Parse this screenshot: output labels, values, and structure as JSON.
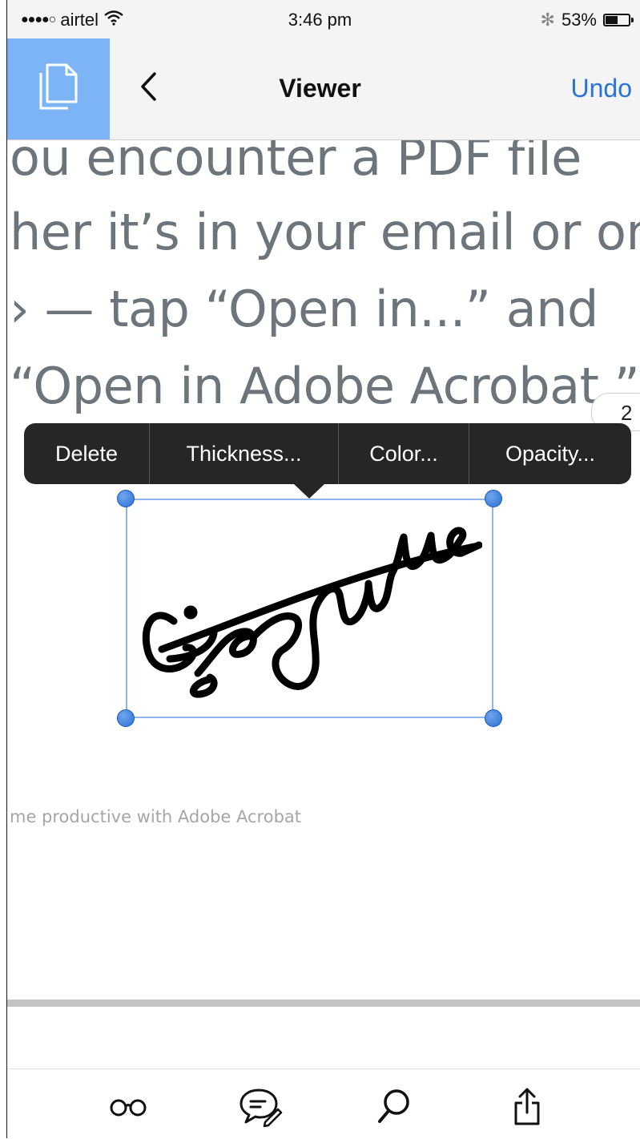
{
  "status_bar": {
    "signal_dots": "●●●●○",
    "carrier": "airtel",
    "time": "3:46 pm",
    "bluetooth_glyph": "✻",
    "battery_percent": "53%",
    "battery_level": 0.53,
    "wifi_icon": "wifi-icon",
    "bluetooth_icon": "bluetooth-icon",
    "battery_icon": "battery-icon"
  },
  "nav": {
    "title": "Viewer",
    "undo_label": "Undo",
    "documents_icon": "documents-icon",
    "back_icon": "chevron-left-icon",
    "accent_color": "#7db4f5",
    "link_color": "#2a73d9"
  },
  "document": {
    "lines": [
      "ou encounter a PDF file",
      "her it’s in your email or on",
      "› — tap “Open in...” and",
      "“Open in Adobe Acrobat.”"
    ],
    "page_number": "2",
    "footer_note": "me productive with Adobe Acrobat",
    "text_color": "#6d757b"
  },
  "context_menu": {
    "items": [
      "Delete",
      "Thickness...",
      "Color...",
      "Opacity..."
    ]
  },
  "signature": {
    "kind": "handwritten signature annotation",
    "text": "Signature",
    "selection_color": "#8fb6f0"
  },
  "toolbar": {
    "icons": [
      "reading-mode-icon",
      "comment-icon",
      "search-icon",
      "share-icon"
    ]
  }
}
